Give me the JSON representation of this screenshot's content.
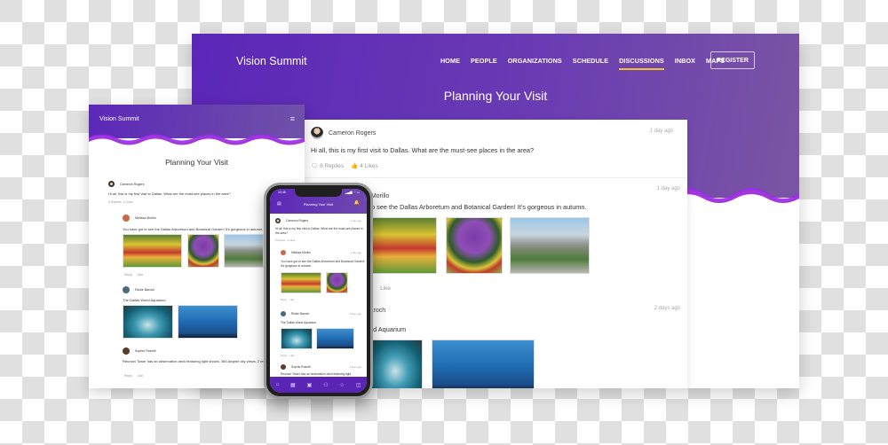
{
  "desktop": {
    "brand": "Vision Summit",
    "nav": [
      {
        "label": "HOME",
        "active": false
      },
      {
        "label": "PEOPLE",
        "active": false
      },
      {
        "label": "ORGANIZATIONS",
        "active": false
      },
      {
        "label": "SCHEDULE",
        "active": false
      },
      {
        "label": "DISCUSSIONS",
        "active": true
      },
      {
        "label": "INBOX",
        "active": false
      },
      {
        "label": "MAPS",
        "active": false
      }
    ],
    "register_label": "REGISTER",
    "page_title": "Planning Your Visit",
    "accent_color": "#f3c130",
    "posts": [
      {
        "author": "Cameron Rogers",
        "time": "1 day ago",
        "text": "Hi all, this is my first visit to Dallas. What are the must-see places in the area?",
        "replies": "8 Replies",
        "likes": "4 Likes"
      },
      {
        "author": "Melissa Morillo",
        "author_visible": "a Morillo",
        "time": "1 day ago",
        "text_visible": "t to see the Dallas Arboretum and Botanical Garden! It's gorgeous in autumn.",
        "like": "Like"
      },
      {
        "author_visible": "Baroch",
        "time": "2 days ago",
        "text_visible": "orld Aquarium"
      }
    ]
  },
  "tablet": {
    "brand": "Vision Summit",
    "menu_icon": "hamburger-icon",
    "page_title": "Planning Your Visit",
    "posts": [
      {
        "author": "Cameron Rogers",
        "text": "Hi all, this is my first visit to Dallas. What are the must-see places in the area?",
        "replies": "8 Replies",
        "likes": "4 Likes"
      },
      {
        "author": "Melissa Morillo",
        "text": "You have got to see the Dallas Arboretum and Botanical Garden! It's gorgeous in autumn.",
        "reply": "Reply",
        "like": "Like"
      },
      {
        "author": "Rickie Baroch",
        "text": "The Dallas World Aquarium",
        "reply": "Reply",
        "like": "Like"
      },
      {
        "author": "Sophie Rosetti",
        "text": "Reunion Tower has an observation deck featuring light shows, 360-degree city views, 2 re... Great for a night out.",
        "reply": "Reply",
        "like": "Like"
      }
    ]
  },
  "phone": {
    "clock": "10:45",
    "status": "▂▄▆ ◠ ▭",
    "title": "Planning Your Visit",
    "posts": [
      {
        "author": "Cameron Rogers",
        "time": "1 day ago",
        "text": "Hi all, this is my first visit to Dallas. What are the must-see places in the area?",
        "replies": "8 Replies",
        "likes": "4 Likes"
      },
      {
        "author": "Melissa Morillo",
        "time": "1 day ago",
        "text": "You have got to see the Dallas Arboretum and Botanical Garden! It's gorgeous in autumn.",
        "reply": "Reply",
        "like": "Like"
      },
      {
        "author": "Rickie Baroch",
        "time": "2 days ago",
        "text": "The Dallas World Aquarium",
        "reply": "Reply",
        "like": "Like"
      },
      {
        "author": "Sophie Rosetti",
        "time": "2 days ago",
        "text": "Reunion Tower has an observation deck featuring light"
      }
    ],
    "tabbar": [
      "home-icon",
      "calendar-icon",
      "schedule-icon",
      "person-icon",
      "star-icon",
      "map-icon"
    ]
  },
  "colors": {
    "brand_purple": "#5c27b8",
    "accent_gold": "#f3c130",
    "wave_purple": "#9b2bf0",
    "wave_orange": "#e0a040"
  }
}
